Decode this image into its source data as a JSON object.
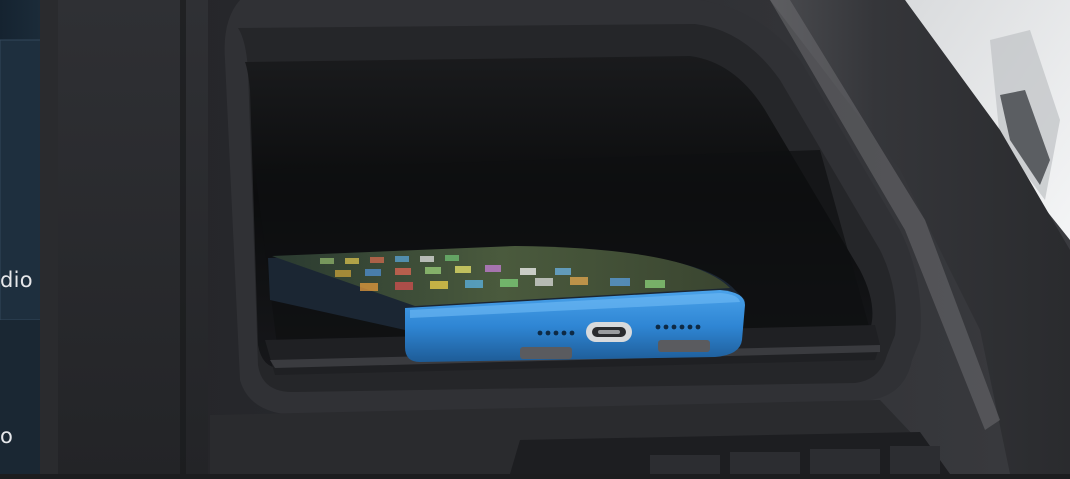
{
  "screen": {
    "visible_labels": [
      "dio",
      "o"
    ]
  },
  "palette": {
    "dash": "#2a2b2e",
    "dash_dark": "#1a1b1d",
    "cubby_inside": "#0d0e10",
    "phone_case": "#2f86d4",
    "phone_case_dark": "#1e5c97",
    "screen_glass": "#3d4a3f",
    "window_bright": "#f2f3f4"
  },
  "icons": {
    "usb_port": "usb-c-port-icon",
    "speaker_grille": "speaker-grille-icon"
  }
}
